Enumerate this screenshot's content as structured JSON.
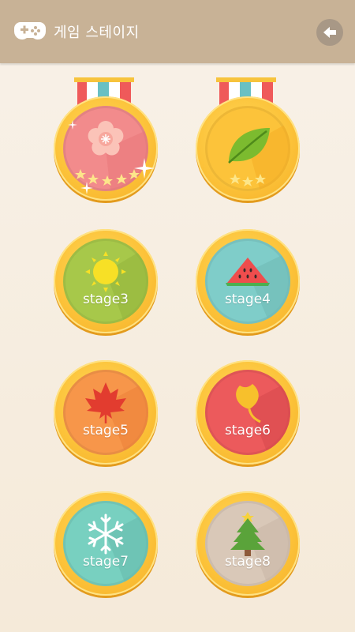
{
  "header": {
    "title": "게임 스테이지",
    "icon": "gamepad-icon",
    "back_icon": "arrow-left-icon",
    "bg_color": "#c8b296"
  },
  "stages": [
    {
      "id": 1,
      "label": "",
      "icon": "plum-blossom-icon",
      "face_color": "#f28b8c",
      "cleared": true,
      "stars": 5
    },
    {
      "id": 2,
      "label": "",
      "icon": "leaf-icon",
      "face_color": "#fcc33a",
      "cleared": true,
      "stars": 3
    },
    {
      "id": 3,
      "label": "stage3",
      "icon": "sun-icon",
      "face_color": "#a7c84a",
      "cleared": false
    },
    {
      "id": 4,
      "label": "stage4",
      "icon": "watermelon-icon",
      "face_color": "#7fcdc9",
      "cleared": false
    },
    {
      "id": 5,
      "label": "stage5",
      "icon": "maple-leaf-icon",
      "face_color": "#f7964a",
      "cleared": false
    },
    {
      "id": 6,
      "label": "stage6",
      "icon": "ginkgo-leaf-icon",
      "face_color": "#ec5a5c",
      "cleared": false
    },
    {
      "id": 7,
      "label": "stage7",
      "icon": "snowflake-icon",
      "face_color": "#78d0c0",
      "cleared": false
    },
    {
      "id": 8,
      "label": "stage8",
      "icon": "christmas-tree-icon",
      "face_color": "#d9c8b8",
      "cleared": false
    }
  ]
}
